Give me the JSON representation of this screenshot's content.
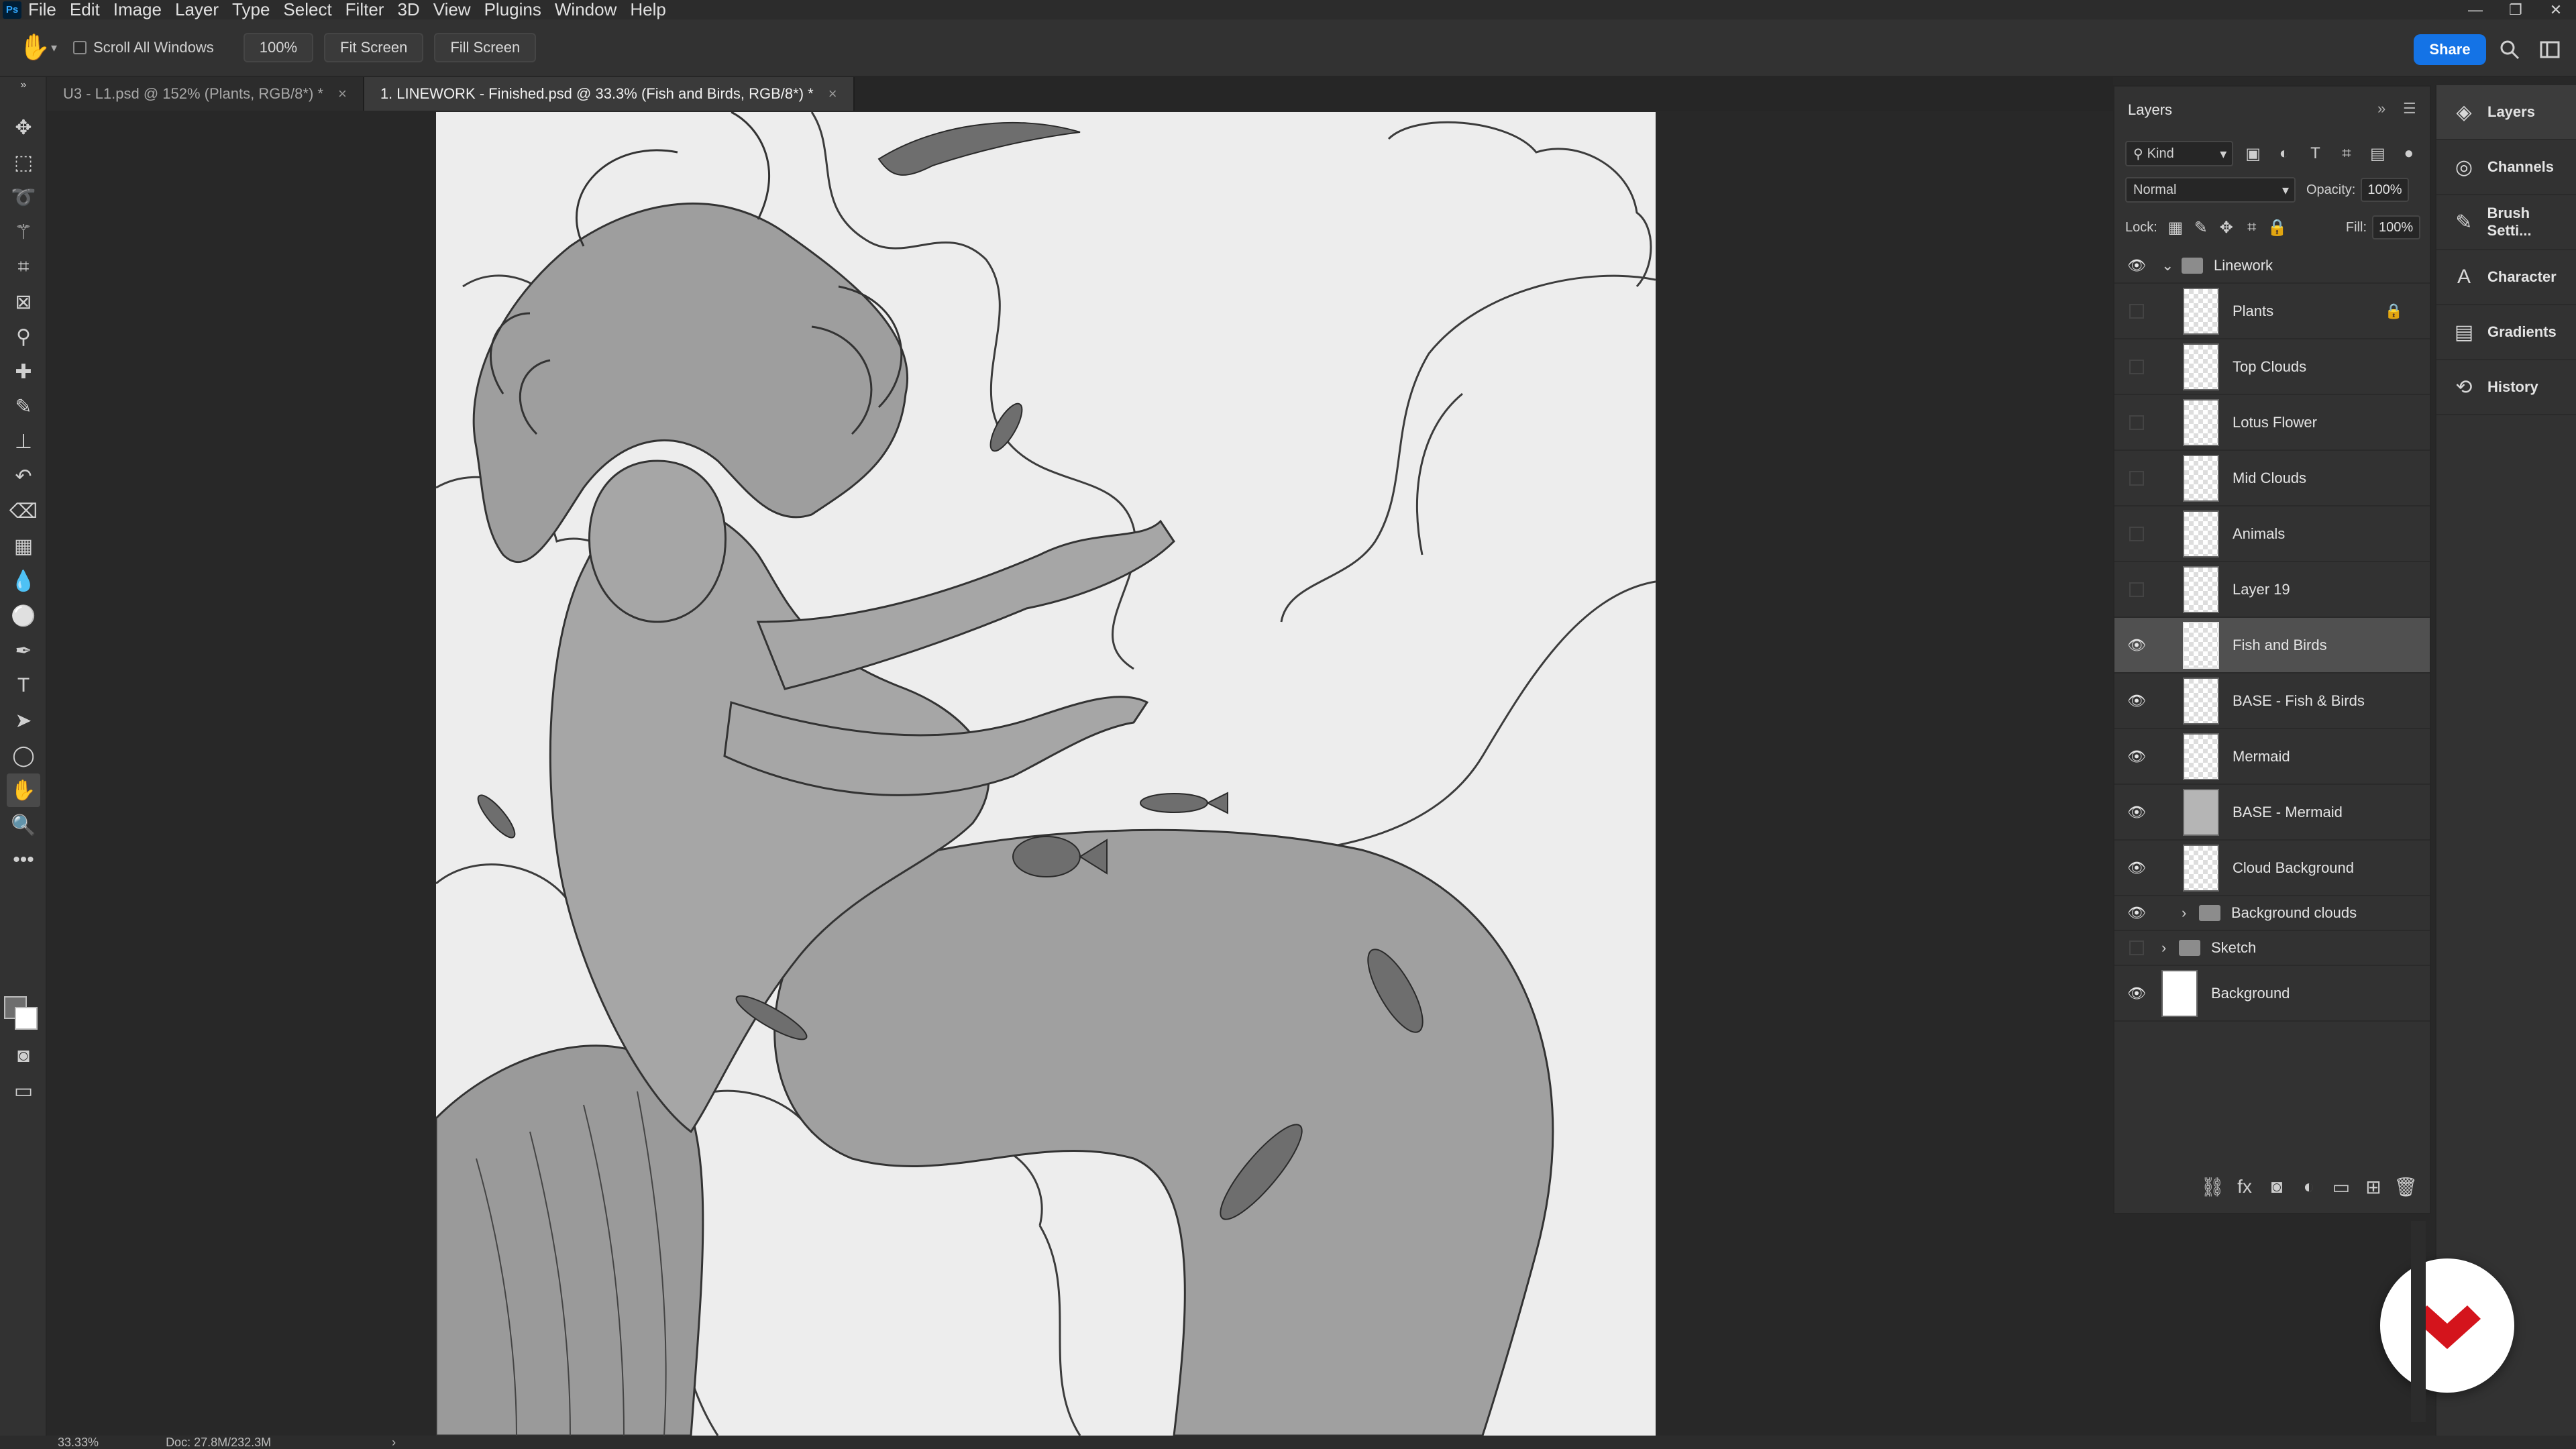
{
  "menu": {
    "logo": "Ps",
    "items": [
      "File",
      "Edit",
      "Image",
      "Layer",
      "Type",
      "Select",
      "Filter",
      "3D",
      "View",
      "Plugins",
      "Window",
      "Help"
    ]
  },
  "options": {
    "scroll_all_windows": "Scroll All Windows",
    "zoom_100": "100%",
    "fit_screen": "Fit Screen",
    "fill_screen": "Fill Screen",
    "share": "Share"
  },
  "tabs": [
    {
      "label": "U3 - L1.psd @ 152% (Plants, RGB/8*) *",
      "active": false
    },
    {
      "label": "1. LINEWORK - Finished.psd @ 33.3% (Fish and Birds, RGB/8*) *",
      "active": true
    }
  ],
  "layers_panel": {
    "title": "Layers",
    "kind": "Kind",
    "blend_mode": "Normal",
    "opacity_label": "Opacity:",
    "opacity": "100%",
    "lock_label": "Lock:",
    "fill_label": "Fill:",
    "fill": "100%",
    "layers": [
      {
        "name": "Linework",
        "type": "group-open",
        "visible": true
      },
      {
        "name": "Plants",
        "type": "layer",
        "visible": false,
        "locked": true
      },
      {
        "name": "Top Clouds",
        "type": "layer",
        "visible": false
      },
      {
        "name": "Lotus Flower",
        "type": "layer",
        "visible": false
      },
      {
        "name": "Mid Clouds",
        "type": "layer",
        "visible": false
      },
      {
        "name": "Animals",
        "type": "layer",
        "visible": false
      },
      {
        "name": "Layer 19",
        "type": "layer",
        "visible": false
      },
      {
        "name": "Fish and Birds",
        "type": "layer",
        "visible": true,
        "selected": true
      },
      {
        "name": "BASE - Fish & Birds",
        "type": "layer",
        "visible": true
      },
      {
        "name": "Mermaid",
        "type": "layer",
        "visible": true
      },
      {
        "name": "BASE - Mermaid",
        "type": "layer",
        "visible": true
      },
      {
        "name": "Cloud Background",
        "type": "layer",
        "visible": true
      },
      {
        "name": "Background clouds",
        "type": "group-closed",
        "visible": true
      },
      {
        "name": "Sketch",
        "type": "group-closed-top",
        "visible": false
      },
      {
        "name": "Background",
        "type": "background",
        "visible": true
      }
    ]
  },
  "dock": [
    {
      "label": "Layers",
      "icon": "layers-icon"
    },
    {
      "label": "Channels",
      "icon": "channels-icon"
    },
    {
      "label": "Brush Setti...",
      "icon": "brush-settings-icon"
    },
    {
      "label": "Character",
      "icon": "character-icon"
    },
    {
      "label": "Gradients",
      "icon": "gradients-icon"
    },
    {
      "label": "History",
      "icon": "history-icon"
    }
  ],
  "status": {
    "zoom": "33.33%",
    "doc": "Doc: 27.8M/232.3M"
  },
  "colors": {
    "accent": "#1473e6",
    "brand_red": "#d4141c",
    "canvas_paper": "#ededed",
    "selected_layer": "#505050"
  }
}
